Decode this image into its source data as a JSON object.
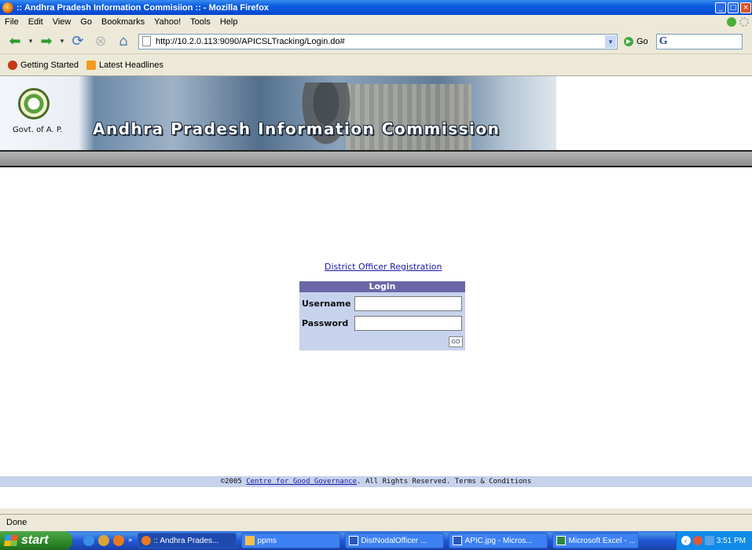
{
  "window": {
    "title": ":: Andhra Pradesh Information Commisiion :: - Mozilla Firefox"
  },
  "menu": [
    "File",
    "Edit",
    "View",
    "Go",
    "Bookmarks",
    "Yahoo!",
    "Tools",
    "Help"
  ],
  "nav": {
    "url": "http://10.2.0.113:9090/APICSLTracking/Login.do#",
    "go_label": "Go"
  },
  "bookmarks": [
    "Getting Started",
    "Latest Headlines"
  ],
  "banner": {
    "govt_label": "Govt. of A. P.",
    "headline": "Andhra Pradesh Information Commission"
  },
  "registration_link": "District Officer Registration",
  "login": {
    "header": "Login",
    "username_label": "Username",
    "password_label": "Password",
    "username_value": "",
    "password_value": "",
    "go_button": "GO"
  },
  "footer": {
    "copyright": "©2005",
    "link": "Centre for Good Governance",
    "rest": ". All Rights Reserved. Terms & Conditions"
  },
  "status": "Done",
  "taskbar": {
    "start": "start",
    "tasks": [
      "Andhra Prades...",
      "ppms",
      "DistNodalOfficer ...",
      "APIC.jpg - Micros...",
      "Microsoft Excel - ..."
    ],
    "clock": "3:51 PM"
  }
}
